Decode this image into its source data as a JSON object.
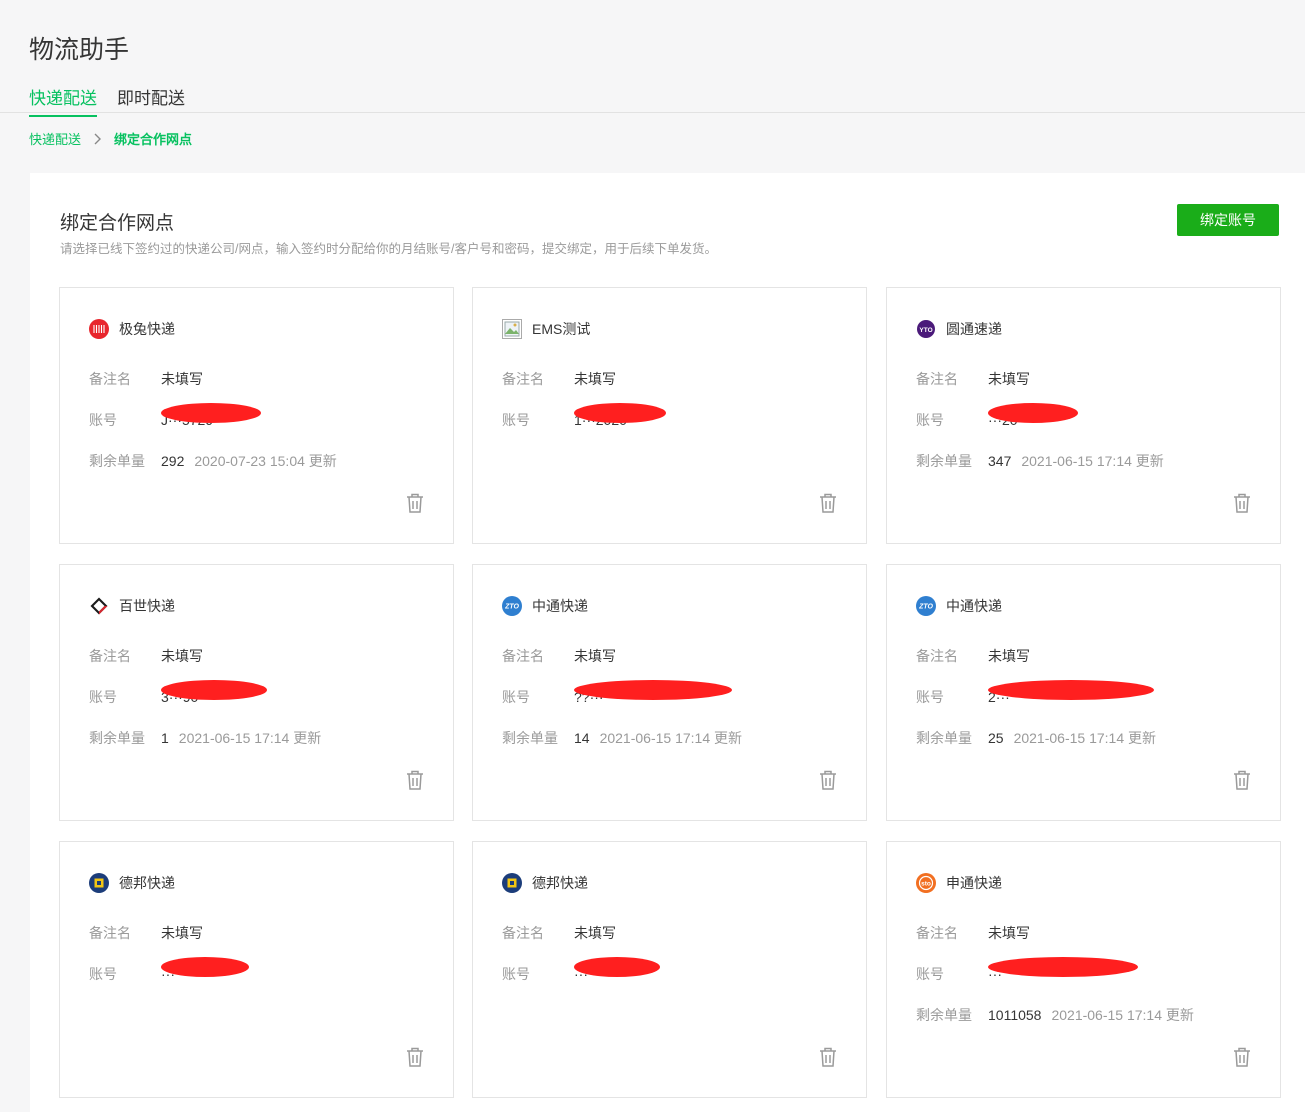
{
  "app_title": "物流助手",
  "tabs": [
    {
      "label": "快递配送",
      "active": true
    },
    {
      "label": "即时配送",
      "active": false
    }
  ],
  "breadcrumb": {
    "root": "快递配送",
    "current": "绑定合作网点"
  },
  "panel": {
    "title": "绑定合作网点",
    "description": "请选择已线下签约过的快递公司/网点，输入签约时分配给你的月结账号/客户号和密码，提交绑定，用于后续下单发货。",
    "bind_button": "绑定账号"
  },
  "labels": {
    "note": "备注名",
    "account": "账号",
    "remaining": "剩余单量"
  },
  "colors": {
    "accent_green": "#07c160",
    "button_green": "#1aad19",
    "redaction_red": "#ff1f1f"
  },
  "cards": [
    {
      "carrier": "极兔快递",
      "icon": "jitu-logo-icon",
      "note": "未填写",
      "account": "J···5729",
      "remaining": "292",
      "updated": "2020-07-23 15:04 更新"
    },
    {
      "carrier": "EMS测试",
      "icon": "broken-image-icon",
      "note": "未填写",
      "account": "1···2020",
      "remaining": null,
      "updated": null
    },
    {
      "carrier": "圆通速递",
      "icon": "yto-logo-icon",
      "note": "未填写",
      "account": "···20",
      "remaining": "347",
      "updated": "2021-06-15 17:14 更新"
    },
    {
      "carrier": "百世快递",
      "icon": "best-logo-icon",
      "note": "未填写",
      "account": "3···90",
      "remaining": "1",
      "updated": "2021-06-15 17:14 更新"
    },
    {
      "carrier": "中通快递",
      "icon": "zto-logo-icon",
      "note": "未填写",
      "account": "??···",
      "remaining": "14",
      "updated": "2021-06-15 17:14 更新"
    },
    {
      "carrier": "中通快递",
      "icon": "zto-logo-icon",
      "note": "未填写",
      "account": "2···",
      "remaining": "25",
      "updated": "2021-06-15 17:14 更新"
    },
    {
      "carrier": "德邦快递",
      "icon": "deppon-logo-icon",
      "note": "未填写",
      "account": "···",
      "remaining": null,
      "updated": null
    },
    {
      "carrier": "德邦快递",
      "icon": "deppon-logo-icon",
      "note": "未填写",
      "account": "···",
      "remaining": null,
      "updated": null
    },
    {
      "carrier": "申通快递",
      "icon": "sto-logo-icon",
      "note": "未填写",
      "account": "···",
      "remaining": "1011058",
      "updated": "2021-06-15 17:14 更新"
    }
  ]
}
